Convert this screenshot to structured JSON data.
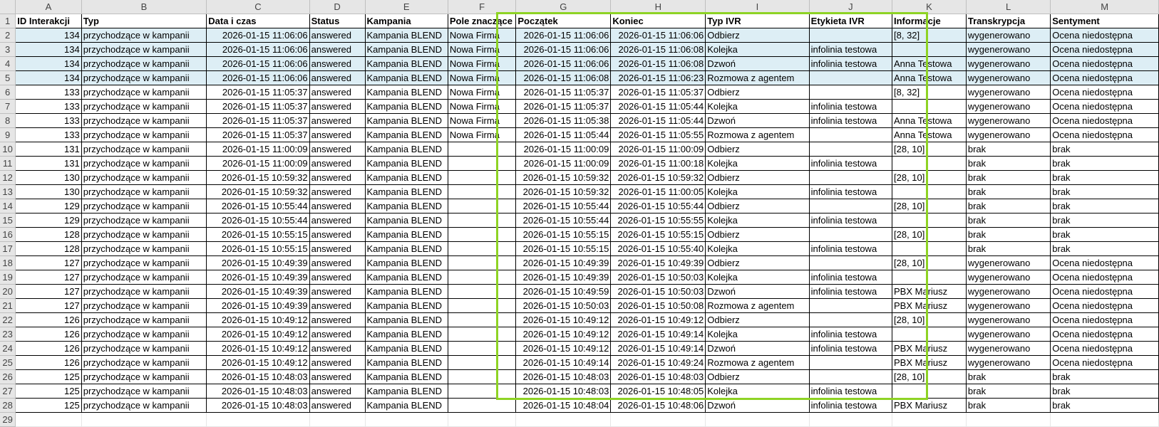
{
  "columns": [
    "A",
    "B",
    "C",
    "D",
    "E",
    "F",
    "G",
    "H",
    "I",
    "J",
    "K",
    "L",
    "M"
  ],
  "headers": [
    "ID Interakcji",
    "Typ",
    "Data i czas",
    "Status",
    "Kampania",
    "Pole znaczące",
    "Początek",
    "Koniec",
    "Typ IVR",
    "Etykieta IVR",
    "Informacje",
    "Transkrypcja",
    "Sentyment"
  ],
  "rows": [
    [
      "134",
      "przychodzące w kampanii",
      "2026-01-15 11:06:06",
      "answered",
      "Kampania BLEND",
      "Nowa Firma",
      "2026-01-15 11:06:06",
      "2026-01-15 11:06:06",
      "Odbierz",
      "",
      "[8, 32]",
      "wygenerowano",
      "Ocena niedostępna"
    ],
    [
      "134",
      "przychodzące w kampanii",
      "2026-01-15 11:06:06",
      "answered",
      "Kampania BLEND",
      "Nowa Firma",
      "2026-01-15 11:06:06",
      "2026-01-15 11:06:08",
      "Kolejka",
      "infolinia testowa",
      "",
      "wygenerowano",
      "Ocena niedostępna"
    ],
    [
      "134",
      "przychodzące w kampanii",
      "2026-01-15 11:06:06",
      "answered",
      "Kampania BLEND",
      "Nowa Firma",
      "2026-01-15 11:06:06",
      "2026-01-15 11:06:08",
      "Dzwoń",
      "infolinia testowa",
      "Anna Testowa",
      "wygenerowano",
      "Ocena niedostępna"
    ],
    [
      "134",
      "przychodzące w kampanii",
      "2026-01-15 11:06:06",
      "answered",
      "Kampania BLEND",
      "Nowa Firma",
      "2026-01-15 11:06:08",
      "2026-01-15 11:06:23",
      "Rozmowa z agentem",
      "",
      "Anna Testowa",
      "wygenerowano",
      "Ocena niedostępna"
    ],
    [
      "133",
      "przychodzące w kampanii",
      "2026-01-15 11:05:37",
      "answered",
      "Kampania BLEND",
      "Nowa Firma",
      "2026-01-15 11:05:37",
      "2026-01-15 11:05:37",
      "Odbierz",
      "",
      "[8, 32]",
      "wygenerowano",
      "Ocena niedostępna"
    ],
    [
      "133",
      "przychodzące w kampanii",
      "2026-01-15 11:05:37",
      "answered",
      "Kampania BLEND",
      "Nowa Firma",
      "2026-01-15 11:05:37",
      "2026-01-15 11:05:44",
      "Kolejka",
      "infolinia testowa",
      "",
      "wygenerowano",
      "Ocena niedostępna"
    ],
    [
      "133",
      "przychodzące w kampanii",
      "2026-01-15 11:05:37",
      "answered",
      "Kampania BLEND",
      "Nowa Firma",
      "2026-01-15 11:05:38",
      "2026-01-15 11:05:44",
      "Dzwoń",
      "infolinia testowa",
      "Anna Testowa",
      "wygenerowano",
      "Ocena niedostępna"
    ],
    [
      "133",
      "przychodzące w kampanii",
      "2026-01-15 11:05:37",
      "answered",
      "Kampania BLEND",
      "Nowa Firma",
      "2026-01-15 11:05:44",
      "2026-01-15 11:05:55",
      "Rozmowa z agentem",
      "",
      "Anna Testowa",
      "wygenerowano",
      "Ocena niedostępna"
    ],
    [
      "131",
      "przychodzące w kampanii",
      "2026-01-15 11:00:09",
      "answered",
      "Kampania BLEND",
      "",
      "2026-01-15 11:00:09",
      "2026-01-15 11:00:09",
      "Odbierz",
      "",
      "[28, 10]",
      "brak",
      "brak"
    ],
    [
      "131",
      "przychodzące w kampanii",
      "2026-01-15 11:00:09",
      "answered",
      "Kampania BLEND",
      "",
      "2026-01-15 11:00:09",
      "2026-01-15 11:00:18",
      "Kolejka",
      "infolinia testowa",
      "",
      "brak",
      "brak"
    ],
    [
      "130",
      "przychodzące w kampanii",
      "2026-01-15 10:59:32",
      "answered",
      "Kampania BLEND",
      "",
      "2026-01-15 10:59:32",
      "2026-01-15 10:59:32",
      "Odbierz",
      "",
      "[28, 10]",
      "brak",
      "brak"
    ],
    [
      "130",
      "przychodzące w kampanii",
      "2026-01-15 10:59:32",
      "answered",
      "Kampania BLEND",
      "",
      "2026-01-15 10:59:32",
      "2026-01-15 11:00:05",
      "Kolejka",
      "infolinia testowa",
      "",
      "brak",
      "brak"
    ],
    [
      "129",
      "przychodzące w kampanii",
      "2026-01-15 10:55:44",
      "answered",
      "Kampania BLEND",
      "",
      "2026-01-15 10:55:44",
      "2026-01-15 10:55:44",
      "Odbierz",
      "",
      "[28, 10]",
      "brak",
      "brak"
    ],
    [
      "129",
      "przychodzące w kampanii",
      "2026-01-15 10:55:44",
      "answered",
      "Kampania BLEND",
      "",
      "2026-01-15 10:55:44",
      "2026-01-15 10:55:55",
      "Kolejka",
      "infolinia testowa",
      "",
      "brak",
      "brak"
    ],
    [
      "128",
      "przychodzące w kampanii",
      "2026-01-15 10:55:15",
      "answered",
      "Kampania BLEND",
      "",
      "2026-01-15 10:55:15",
      "2026-01-15 10:55:15",
      "Odbierz",
      "",
      "[28, 10]",
      "brak",
      "brak"
    ],
    [
      "128",
      "przychodzące w kampanii",
      "2026-01-15 10:55:15",
      "answered",
      "Kampania BLEND",
      "",
      "2026-01-15 10:55:15",
      "2026-01-15 10:55:40",
      "Kolejka",
      "infolinia testowa",
      "",
      "brak",
      "brak"
    ],
    [
      "127",
      "przychodzące w kampanii",
      "2026-01-15 10:49:39",
      "answered",
      "Kampania BLEND",
      "",
      "2026-01-15 10:49:39",
      "2026-01-15 10:49:39",
      "Odbierz",
      "",
      "[28, 10]",
      "wygenerowano",
      "Ocena niedostępna"
    ],
    [
      "127",
      "przychodzące w kampanii",
      "2026-01-15 10:49:39",
      "answered",
      "Kampania BLEND",
      "",
      "2026-01-15 10:49:39",
      "2026-01-15 10:50:03",
      "Kolejka",
      "infolinia testowa",
      "",
      "wygenerowano",
      "Ocena niedostępna"
    ],
    [
      "127",
      "przychodzące w kampanii",
      "2026-01-15 10:49:39",
      "answered",
      "Kampania BLEND",
      "",
      "2026-01-15 10:49:59",
      "2026-01-15 10:50:03",
      "Dzwoń",
      "infolinia testowa",
      "PBX Mariusz",
      "wygenerowano",
      "Ocena niedostępna"
    ],
    [
      "127",
      "przychodzące w kampanii",
      "2026-01-15 10:49:39",
      "answered",
      "Kampania BLEND",
      "",
      "2026-01-15 10:50:03",
      "2026-01-15 10:50:08",
      "Rozmowa z agentem",
      "",
      "PBX Mariusz",
      "wygenerowano",
      "Ocena niedostępna"
    ],
    [
      "126",
      "przychodzące w kampanii",
      "2026-01-15 10:49:12",
      "answered",
      "Kampania BLEND",
      "",
      "2026-01-15 10:49:12",
      "2026-01-15 10:49:12",
      "Odbierz",
      "",
      "[28, 10]",
      "wygenerowano",
      "Ocena niedostępna"
    ],
    [
      "126",
      "przychodzące w kampanii",
      "2026-01-15 10:49:12",
      "answered",
      "Kampania BLEND",
      "",
      "2026-01-15 10:49:12",
      "2026-01-15 10:49:14",
      "Kolejka",
      "infolinia testowa",
      "",
      "wygenerowano",
      "Ocena niedostępna"
    ],
    [
      "126",
      "przychodzące w kampanii",
      "2026-01-15 10:49:12",
      "answered",
      "Kampania BLEND",
      "",
      "2026-01-15 10:49:12",
      "2026-01-15 10:49:14",
      "Dzwoń",
      "infolinia testowa",
      "PBX Mariusz",
      "wygenerowano",
      "Ocena niedostępna"
    ],
    [
      "126",
      "przychodzące w kampanii",
      "2026-01-15 10:49:12",
      "answered",
      "Kampania BLEND",
      "",
      "2026-01-15 10:49:14",
      "2026-01-15 10:49:24",
      "Rozmowa z agentem",
      "",
      "PBX Mariusz",
      "wygenerowano",
      "Ocena niedostępna"
    ],
    [
      "125",
      "przychodzące w kampanii",
      "2026-01-15 10:48:03",
      "answered",
      "Kampania BLEND",
      "",
      "2026-01-15 10:48:03",
      "2026-01-15 10:48:03",
      "Odbierz",
      "",
      "[28, 10]",
      "brak",
      "brak"
    ],
    [
      "125",
      "przychodzące w kampanii",
      "2026-01-15 10:48:03",
      "answered",
      "Kampania BLEND",
      "",
      "2026-01-15 10:48:03",
      "2026-01-15 10:48:05",
      "Kolejka",
      "infolinia testowa",
      "",
      "brak",
      "brak"
    ],
    [
      "125",
      "przychodzące w kampanii",
      "2026-01-15 10:48:03",
      "answered",
      "Kampania BLEND",
      "",
      "2026-01-15 10:48:04",
      "2026-01-15 10:48:06",
      "Dzwoń",
      "infolinia testowa",
      "PBX Mariusz",
      "brak",
      "brak"
    ]
  ],
  "row_numbers": [
    "1",
    "2",
    "3",
    "4",
    "5",
    "6",
    "7",
    "8",
    "9",
    "10",
    "11",
    "12",
    "13",
    "14",
    "15",
    "16",
    "17",
    "18",
    "19",
    "20",
    "21",
    "22",
    "23",
    "24",
    "25",
    "26",
    "27",
    "28",
    "29"
  ],
  "highlighted_rows": [
    0,
    1,
    2,
    3
  ],
  "colors": {
    "selection_box": "#8ed324",
    "row_highlight": "#ddeef5",
    "header_bg": "#e6e6e6"
  }
}
